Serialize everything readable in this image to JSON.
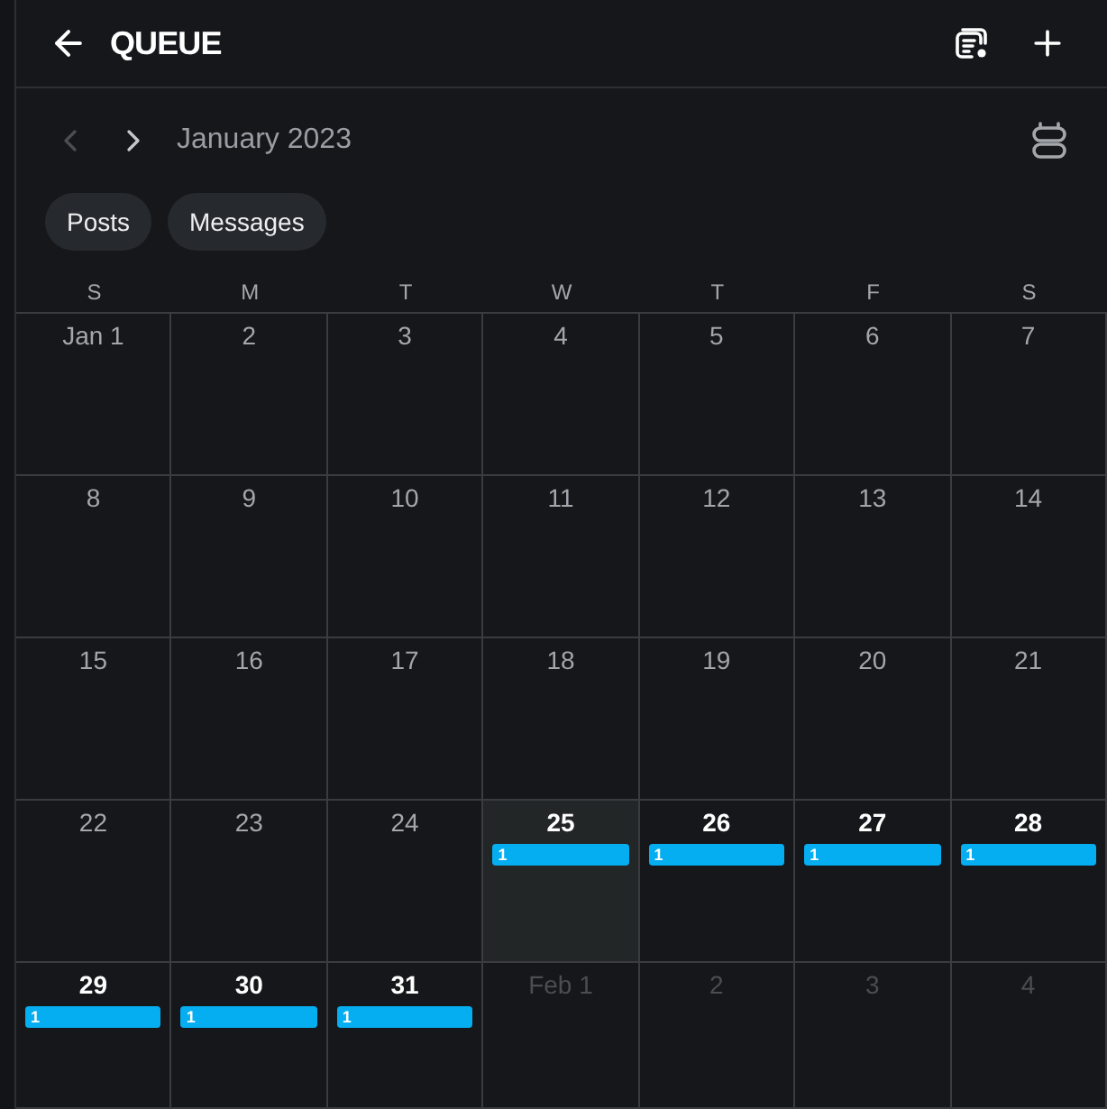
{
  "header": {
    "title": "QUEUE"
  },
  "month_nav": {
    "prev": {
      "disabled": true
    },
    "next": {
      "disabled": false
    },
    "label": "January 2023"
  },
  "filters": [
    {
      "label": "Posts"
    },
    {
      "label": "Messages"
    }
  ],
  "calendar": {
    "weekdays": [
      "S",
      "M",
      "T",
      "W",
      "T",
      "F",
      "S"
    ],
    "weeks": [
      [
        {
          "date": "Jan 1",
          "kind": "past"
        },
        {
          "date": "2",
          "kind": "past"
        },
        {
          "date": "3",
          "kind": "past"
        },
        {
          "date": "4",
          "kind": "past"
        },
        {
          "date": "5",
          "kind": "past"
        },
        {
          "date": "6",
          "kind": "past"
        },
        {
          "date": "7",
          "kind": "past"
        }
      ],
      [
        {
          "date": "8",
          "kind": "past"
        },
        {
          "date": "9",
          "kind": "past"
        },
        {
          "date": "10",
          "kind": "past"
        },
        {
          "date": "11",
          "kind": "past"
        },
        {
          "date": "12",
          "kind": "past"
        },
        {
          "date": "13",
          "kind": "past"
        },
        {
          "date": "14",
          "kind": "past"
        }
      ],
      [
        {
          "date": "15",
          "kind": "past"
        },
        {
          "date": "16",
          "kind": "past"
        },
        {
          "date": "17",
          "kind": "past"
        },
        {
          "date": "18",
          "kind": "past"
        },
        {
          "date": "19",
          "kind": "past"
        },
        {
          "date": "20",
          "kind": "past"
        },
        {
          "date": "21",
          "kind": "past"
        }
      ],
      [
        {
          "date": "22",
          "kind": "past"
        },
        {
          "date": "23",
          "kind": "past"
        },
        {
          "date": "24",
          "kind": "past"
        },
        {
          "date": "25",
          "kind": "today",
          "events": [
            "1"
          ]
        },
        {
          "date": "26",
          "kind": "upcoming",
          "events": [
            "1"
          ]
        },
        {
          "date": "27",
          "kind": "upcoming",
          "events": [
            "1"
          ]
        },
        {
          "date": "28",
          "kind": "upcoming",
          "events": [
            "1"
          ]
        }
      ],
      [
        {
          "date": "29",
          "kind": "upcoming",
          "events": [
            "1"
          ]
        },
        {
          "date": "30",
          "kind": "upcoming",
          "events": [
            "1"
          ]
        },
        {
          "date": "31",
          "kind": "upcoming",
          "events": [
            "1"
          ]
        },
        {
          "date": "Feb 1",
          "kind": "next_month"
        },
        {
          "date": "2",
          "kind": "next_month"
        },
        {
          "date": "3",
          "kind": "next_month"
        },
        {
          "date": "4",
          "kind": "next_month"
        }
      ]
    ]
  }
}
